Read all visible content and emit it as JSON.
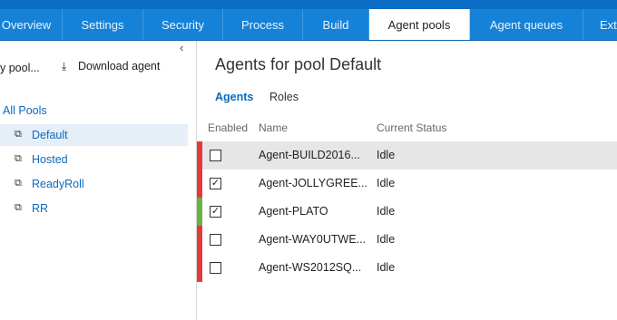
{
  "tabs": [
    {
      "label": "Overview"
    },
    {
      "label": "Settings"
    },
    {
      "label": "Security"
    },
    {
      "label": "Process"
    },
    {
      "label": "Build"
    },
    {
      "label": "Agent pools"
    },
    {
      "label": "Agent queues"
    },
    {
      "label": "Ext"
    }
  ],
  "active_tab": "Agent pools",
  "left_panel": {
    "collapse_icon": "chevron-left-icon",
    "new_pool_label": "y pool...",
    "download_label": "Download agent",
    "download_icon": "download-icon",
    "all_pools_label": "All Pools",
    "pools": [
      {
        "label": "Default"
      },
      {
        "label": "Hosted"
      },
      {
        "label": "ReadyRoll"
      },
      {
        "label": "RR"
      }
    ],
    "selected_pool": "Default",
    "pool_icon": "agent-pool-icon"
  },
  "main": {
    "title": "Agents for pool Default",
    "tabs": [
      {
        "label": "Agents"
      },
      {
        "label": "Roles"
      }
    ],
    "columns": {
      "enabled": "Enabled",
      "name": "Name",
      "status": "Current Status"
    },
    "agents": [
      {
        "enabled": false,
        "name": "Agent-BUILD2016...",
        "status": "Idle",
        "status_color": "#e23b3b"
      },
      {
        "enabled": true,
        "name": "Agent-JOLLYGREE...",
        "status": "Idle",
        "status_color": "#e23b3b"
      },
      {
        "enabled": true,
        "name": "Agent-PLATO",
        "status": "Idle",
        "status_color": "#6ab43e"
      },
      {
        "enabled": false,
        "name": "Agent-WAY0UTWE...",
        "status": "Idle",
        "status_color": "#e23b3b"
      },
      {
        "enabled": false,
        "name": "Agent-WS2012SQ...",
        "status": "Idle",
        "status_color": "#e23b3b"
      }
    ]
  },
  "colors": {
    "accent": "#1582d8",
    "link": "#0a6ac0",
    "offline": "#e23b3b",
    "online": "#6ab43e"
  }
}
